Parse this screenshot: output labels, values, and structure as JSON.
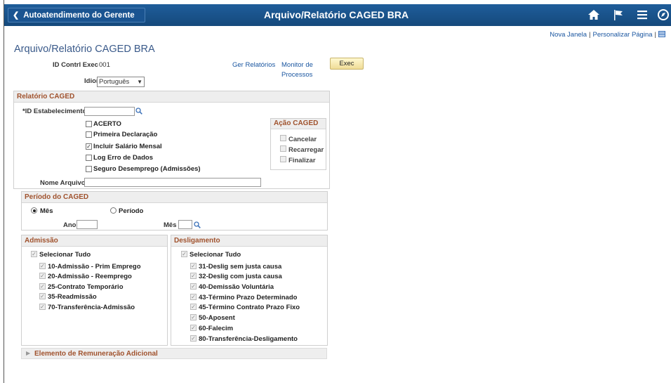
{
  "topbar": {
    "back_label": "Autoatendimento do Gerente",
    "title": "Arquivo/Relatório CAGED BRA",
    "icons": [
      "home-icon",
      "flag-icon",
      "menu-icon",
      "navbar-icon"
    ]
  },
  "header_links": {
    "new_window": "Nova Janela",
    "personalize": "Personalizar Página",
    "sep": "|"
  },
  "page_title": "Arquivo/Relatório CAGED BRA",
  "run_control": {
    "label": "ID Contrl Exec",
    "value": "001"
  },
  "language": {
    "label": "Idioma",
    "value": "Português"
  },
  "links": {
    "report_manager": "Ger Relatórios",
    "process_monitor_1": "Monitor de",
    "process_monitor_2": "Processos"
  },
  "exec_label": "Exec",
  "relatorio": {
    "title": "Relatório CAGED",
    "establishment_label": "*ID Estabelecimento",
    "options": [
      {
        "label": "ACERTO",
        "checked": false
      },
      {
        "label": "Primeira Declaração",
        "checked": false
      },
      {
        "label": "Incluir Salário Mensal",
        "checked": true
      },
      {
        "label": "Log Erro de Dados",
        "checked": false
      },
      {
        "label": "Seguro Desemprego (Admissões)",
        "checked": false
      }
    ],
    "file_name_label": "Nome Arquivo",
    "acao": {
      "title": "Ação CAGED",
      "items": [
        "Cancelar",
        "Recarregar",
        "Finalizar"
      ]
    }
  },
  "periodo": {
    "title": "Período do CAGED",
    "radio_month": "Mês",
    "radio_period": "Período",
    "year_label": "Ano",
    "month_label": "Mês"
  },
  "admissao": {
    "title": "Admissão",
    "select_all": "Selecionar Tudo",
    "items": [
      "10-Admissão - Prim Emprego",
      "20-Admissão - Reemprego",
      "25-Contrato Temporário",
      "35-Readmissão",
      "70-Transferência-Admissão"
    ]
  },
  "desligamento": {
    "title": "Desligamento",
    "select_all": "Selecionar Tudo",
    "items": [
      "31-Deslig sem justa causa",
      "32-Deslig com justa causa",
      "40-Demissão Voluntária",
      "43-Término Prazo Determinado",
      "45-Término Contrato Prazo Fixo",
      "50-Aposent",
      "60-Falecim",
      "80-Transferência-Desligamento"
    ]
  },
  "expander": {
    "title": "Elemento de Remuneração Adicional"
  },
  "colors": {
    "topbar": "#1a5491",
    "section_title": "#a0522d",
    "link": "#1a56a0"
  }
}
